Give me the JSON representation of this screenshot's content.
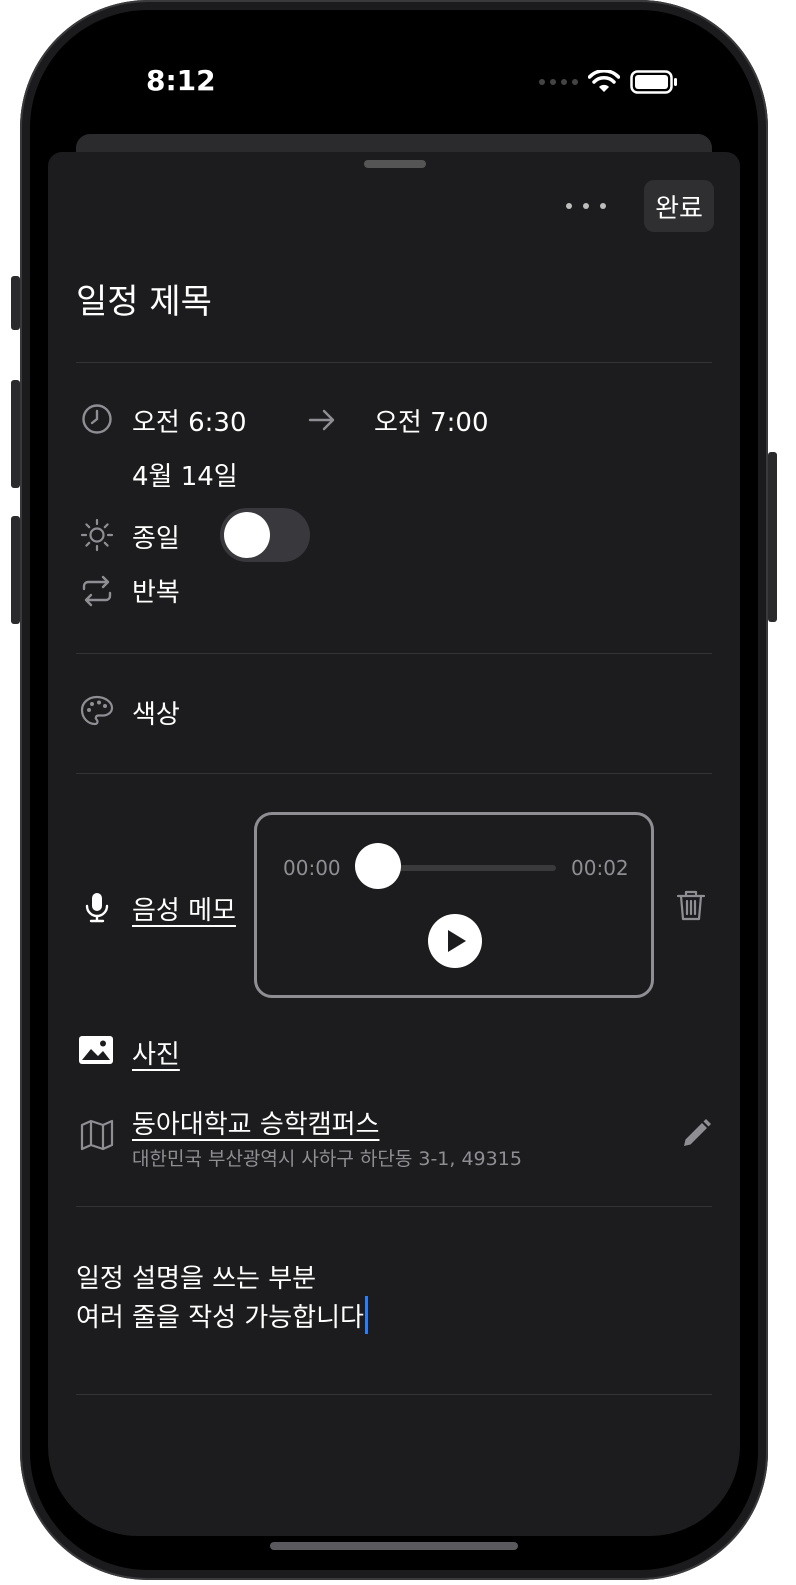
{
  "status_bar": {
    "time": "8:12"
  },
  "header": {
    "more_icon": "ellipsis-icon",
    "done_label": "완료"
  },
  "event": {
    "title": "일정 제목",
    "start_time": "오전 6:30",
    "end_time": "오전 7:00",
    "date": "4월 14일",
    "all_day_label": "종일",
    "all_day_on": false,
    "repeat_label": "반복",
    "color_label": "색상"
  },
  "voice_memo": {
    "label": "음성 메모",
    "current_time": "00:00",
    "duration": "00:02",
    "progress": 0.0
  },
  "photo": {
    "label": "사진"
  },
  "location": {
    "name": "동아대학교 승학캠퍼스",
    "address": "대한민국 부산광역시 사하구 하단동 3-1, 49315"
  },
  "description": {
    "line1": "일정 설명을 쓰는 부분",
    "line2": "여러 줄을 작성 가능합니다"
  },
  "colors": {
    "accent_caret": "#2f7df6",
    "sheet": "#1c1c1e"
  }
}
